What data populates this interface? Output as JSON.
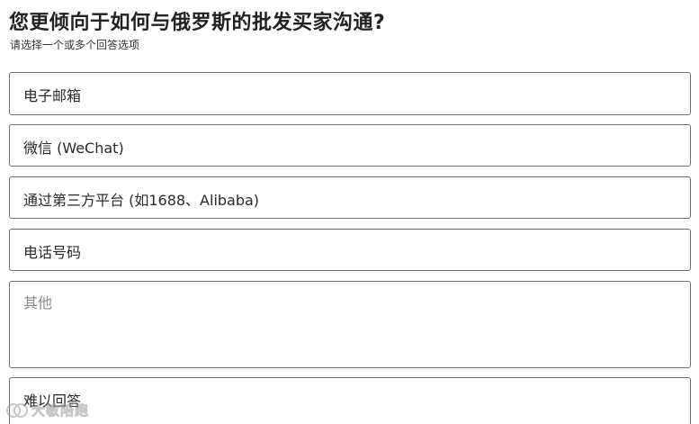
{
  "question": {
    "title": "您更倾向于如何与俄罗斯的批发买家沟通?",
    "hint": "请选择一个或多个回答选项"
  },
  "options": [
    {
      "label": "电子邮箱"
    },
    {
      "label": "微信 (WeChat)"
    },
    {
      "label": "通过第三方平台 (如1688、Alibaba)"
    },
    {
      "label": "电话号码"
    },
    {
      "label": "难以回答"
    }
  ],
  "other": {
    "placeholder": "其他",
    "value": ""
  },
  "watermark": {
    "text": "大敏陪跑"
  }
}
